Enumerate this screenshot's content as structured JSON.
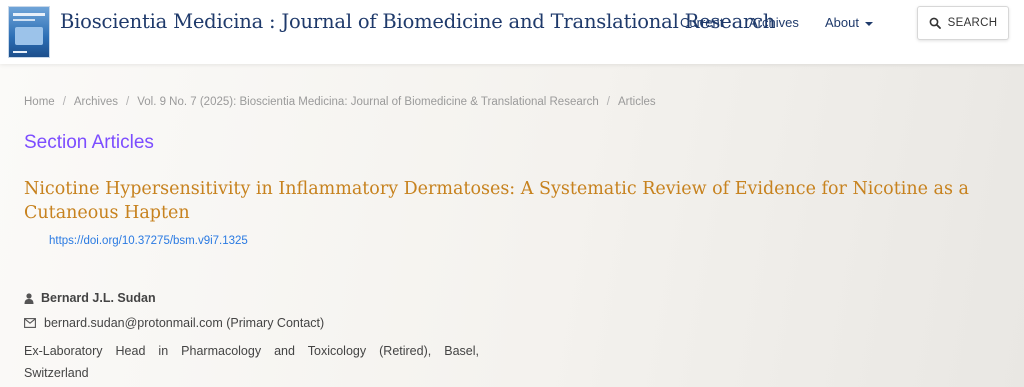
{
  "header": {
    "site_title": "Bioscientia Medicina : Journal of Biomedicine and Translational Research",
    "nav": {
      "current": "Current",
      "archives": "Archives",
      "about": "About"
    },
    "search_label": "SEARCH"
  },
  "breadcrumb": {
    "home": "Home",
    "archives": "Archives",
    "issue": "Vol. 9 No. 7 (2025): Bioscientia Medicina: Journal of Biomedicine & Translational Research",
    "articles": "Articles",
    "separator": "/"
  },
  "section_title": "Section Articles",
  "article": {
    "title": "Nicotine Hypersensitivity in Inflammatory Dermatoses: A Systematic Review of Evidence for Nicotine as a Cutaneous Hapten",
    "doi": "https://doi.org/10.37275/bsm.v9i7.1325"
  },
  "author": {
    "name": "Bernard J.L. Sudan",
    "email": "bernard.sudan@protonmail.com (Primary Contact)",
    "affiliation": "Ex-Laboratory Head in Pharmacology and Toxicology (Retired), Basel, Switzerland"
  },
  "icons": {
    "search": "search-icon",
    "user": "user-icon",
    "email": "envelope-icon",
    "caret": "chevron-down-icon"
  },
  "colors": {
    "title_navy": "#1f3a6b",
    "section_purple": "#7c4dff",
    "article_orange": "#c7821e",
    "link_blue": "#2a7ae2"
  }
}
